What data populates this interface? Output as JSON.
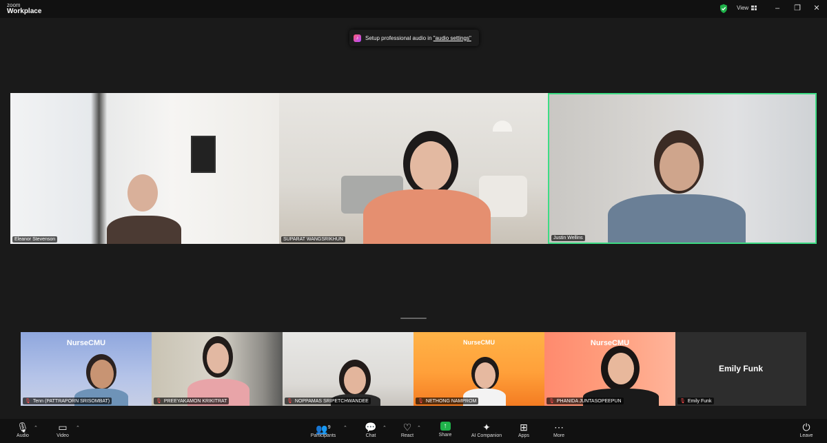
{
  "titlebar": {
    "brand_top": "zoom",
    "brand_bottom": "Workplace",
    "view_label": "View",
    "minimize": "–",
    "maximize": "❐",
    "close": "✕"
  },
  "banner": {
    "text": "Setup professional audio in ",
    "link": "\"audio settings\""
  },
  "speakers": [
    {
      "name": "Eleanor Stevenson"
    },
    {
      "name": "SUPARAT WANGSRIKHUN"
    },
    {
      "name": "Justin Wellins"
    }
  ],
  "gallery": [
    {
      "name": "Tenn (PATTRAPORN SRISOMBAT)",
      "logo": "NurseCMU"
    },
    {
      "name": "PREEYAKAMON KRIKITRAT"
    },
    {
      "name": "NOPPAMAS SRIPETCHWANDEE"
    },
    {
      "name": "NETHONG NAMPROM",
      "logo": "NurseCMU"
    },
    {
      "name": "PHANIDA JUNTASOPEEPUN",
      "logo": "NurseCMU"
    },
    {
      "name": "Emily Funk",
      "display": "Emily Funk"
    }
  ],
  "toolbar": {
    "audio": "Audio",
    "video": "Video",
    "participants": "Participants",
    "participants_count": "9",
    "chat": "Chat",
    "react": "React",
    "share": "Share",
    "ai_companion": "AI Companion",
    "apps": "Apps",
    "more": "More",
    "leave": "Leave"
  },
  "colors": {
    "active_speaker_border": "#3ddc84",
    "share_green": "#1fb24a",
    "muted_red": "#ff4c4c"
  }
}
